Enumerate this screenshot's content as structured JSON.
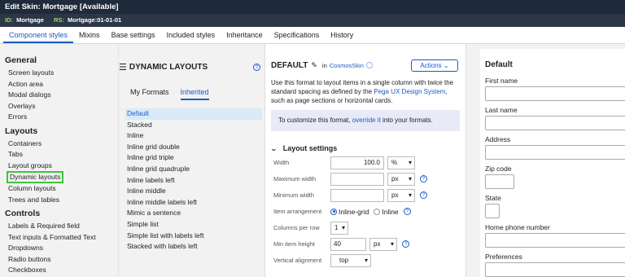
{
  "window": {
    "title": "Edit Skin: Mortgage [Available]"
  },
  "idbar": {
    "id_key": "ID:",
    "id_val": "Mortgage",
    "rs_key": "RS:",
    "rs_val": "Mortgage:01-01-01"
  },
  "tabs": [
    {
      "label": "Component styles",
      "active": true
    },
    {
      "label": "Mixins"
    },
    {
      "label": "Base settings"
    },
    {
      "label": "Included styles"
    },
    {
      "label": "Inheritance"
    },
    {
      "label": "Specifications"
    },
    {
      "label": "History"
    }
  ],
  "leftnav": {
    "general": {
      "heading": "General",
      "items": [
        "Screen layouts",
        "Action area",
        "Modal dialogs",
        "Overlays",
        "Errors"
      ]
    },
    "layouts": {
      "heading": "Layouts",
      "items": [
        "Containers",
        "Tabs",
        "Layout groups",
        "Dynamic layouts",
        "Column layouts",
        "Trees and tables"
      ]
    },
    "controls": {
      "heading": "Controls",
      "items": [
        "Labels & Required field",
        "Text inputs & Formatted Text",
        "Dropdowns",
        "Radio buttons",
        "Checkboxes"
      ]
    }
  },
  "formats_panel": {
    "title": "DYNAMIC LAYOUTS",
    "subtabs": [
      "My Formats",
      "Inherited"
    ],
    "active_subtab": "Inherited",
    "items": [
      "Default",
      "Stacked",
      "Inline",
      "Inline grid double",
      "Inline grid triple",
      "Inline grid quadruple",
      "Inline labels left",
      "Inline middle",
      "Inline middle labels left",
      "Mimic a sentence",
      "Simple list",
      "Simple list with labels left",
      "Stacked with labels left"
    ]
  },
  "editor": {
    "title": "DEFAULT",
    "in_text": "in",
    "skin_link": "CosmosSkin",
    "actions_label": "Actions",
    "desc_pre": "Use this format to layout items in a single column with twice the standard spacing as defined by the ",
    "desc_link": "Pega UX Design System",
    "desc_post": ", such as page sections or horizontal cards.",
    "notice_pre": "To customize this format, ",
    "notice_link": "override it",
    "notice_post": " into your formats.",
    "section_title": "Layout settings",
    "fields": {
      "width": {
        "label": "Width",
        "value": "100.0",
        "unit": "%"
      },
      "max_width": {
        "label": "Maximum width",
        "value": "",
        "unit": "px"
      },
      "min_width": {
        "label": "Minimum width",
        "value": "",
        "unit": "px"
      },
      "arrangement": {
        "label": "Item arrangement",
        "opt1": "Inline-grid",
        "opt2": "Inline"
      },
      "columns": {
        "label": "Columns per row",
        "value": "1"
      },
      "min_height": {
        "label": "Min item height",
        "value": "40",
        "unit": "px"
      },
      "valign": {
        "label": "Vertical alignment",
        "value": "top"
      }
    }
  },
  "preview": {
    "title": "Default",
    "labels": [
      "First name",
      "Last name",
      "Address",
      "Zip code",
      "State",
      "Home phone number",
      "Preferences"
    ]
  }
}
